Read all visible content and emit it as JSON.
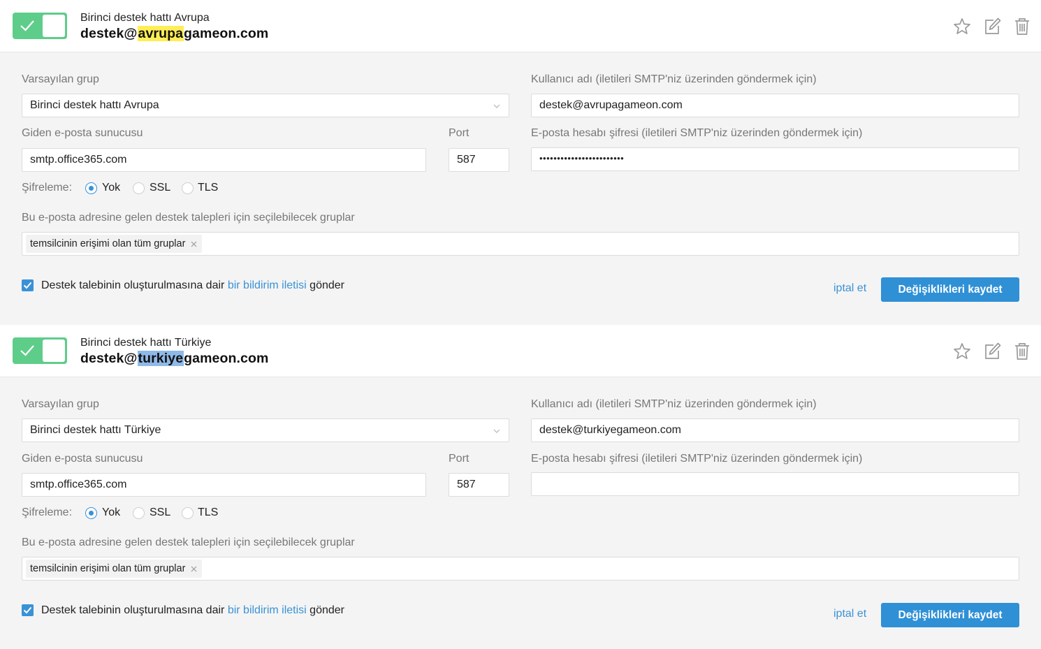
{
  "labels": {
    "default_group": "Varsayılan grup",
    "username": "Kullanıcı adı (iletileri SMTP'niz üzerinden göndermek için)",
    "outgoing_server": "Giden e-posta sunucusu",
    "port": "Port",
    "password": "E-posta hesabı şifresi (iletileri SMTP'niz üzerinden göndermek için)",
    "encryption": "Şifreleme:",
    "groups": "Bu e-posta adresine gelen destek talepleri için seçilebilecek gruplar",
    "notify_prefix": "Destek talebinin oluşturulmasına dair ",
    "notify_link": "bir bildirim iletisi",
    "notify_suffix": " gönder",
    "cancel": "iptal et",
    "save": "Değişiklikleri kaydet"
  },
  "encryption_options": [
    "Yok",
    "SSL",
    "TLS"
  ],
  "colors": {
    "toggle_on": "#5ecd8a",
    "accent": "#2f90d6",
    "highlight_1": "#ffee55",
    "highlight_2": "#8fb9e8"
  },
  "mailboxes": [
    {
      "enabled": true,
      "title": "Birinci destek hattı Avrupa",
      "email_prefix": "destek@",
      "email_highlight": "avrupa",
      "email_suffix": "gameon.com",
      "default_group": "Birinci destek hattı Avrupa",
      "username": "destek@avrupagameon.com",
      "server": "smtp.office365.com",
      "port": "587",
      "password": "••••••••••••••••••••••••",
      "encryption": "Yok",
      "group_tag": "temsilcinin erişimi olan tüm gruplar",
      "notify_checked": true
    },
    {
      "enabled": true,
      "title": "Birinci destek hattı Türkiye",
      "email_prefix": "destek@",
      "email_highlight": "turkiye",
      "email_suffix": "gameon.com",
      "default_group": "Birinci destek hattı Türkiye",
      "username": "destek@turkiyegameon.com",
      "server": "smtp.office365.com",
      "port": "587",
      "password": "",
      "encryption": "Yok",
      "group_tag": "temsilcinin erişimi olan tüm gruplar",
      "notify_checked": true
    }
  ]
}
